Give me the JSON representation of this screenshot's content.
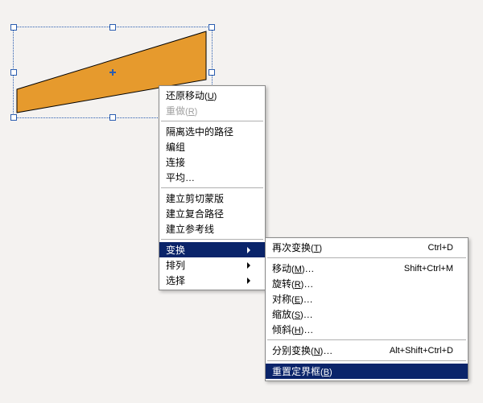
{
  "shape": {
    "fill": "#e69a2d",
    "stroke": "#000000"
  },
  "menu1": {
    "items": [
      {
        "label": "还原移动(U)",
        "mnemonic": "U",
        "disabled": false
      },
      {
        "label": "重做(R)",
        "mnemonic": "R",
        "disabled": true
      },
      {
        "sep": true
      },
      {
        "label": "隔离选中的路径"
      },
      {
        "label": "编组"
      },
      {
        "label": "连接"
      },
      {
        "label": "平均…"
      },
      {
        "sep": true
      },
      {
        "label": "建立剪切蒙版"
      },
      {
        "label": "建立复合路径"
      },
      {
        "label": "建立参考线"
      },
      {
        "sep": true
      },
      {
        "label": "变换",
        "submenu": true,
        "selected": true
      },
      {
        "label": "排列",
        "submenu": true
      },
      {
        "label": "选择",
        "submenu": true
      }
    ]
  },
  "menu2": {
    "items": [
      {
        "label": "再次变换(T)",
        "mnemonic": "T",
        "accel": "Ctrl+D"
      },
      {
        "sep": true
      },
      {
        "label": "移动(M)…",
        "mnemonic": "M",
        "accel": "Shift+Ctrl+M"
      },
      {
        "label": "旋转(R)…",
        "mnemonic": "R"
      },
      {
        "label": "对称(E)…",
        "mnemonic": "E"
      },
      {
        "label": "缩放(S)…",
        "mnemonic": "S"
      },
      {
        "label": "倾斜(H)…",
        "mnemonic": "H"
      },
      {
        "sep": true
      },
      {
        "label": "分别变换(N)…",
        "mnemonic": "N",
        "accel": "Alt+Shift+Ctrl+D"
      },
      {
        "sep": true
      },
      {
        "label": "重置定界框(B)",
        "mnemonic": "B",
        "selected": true
      }
    ]
  }
}
